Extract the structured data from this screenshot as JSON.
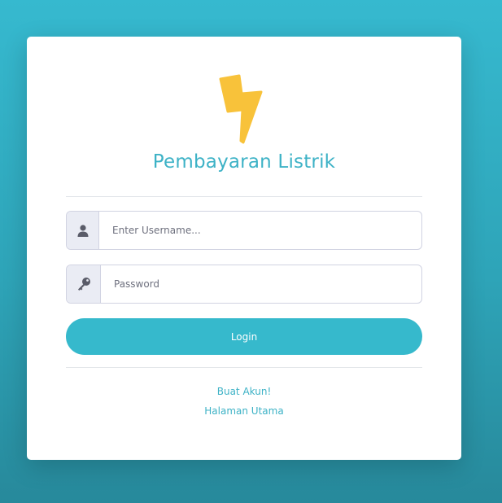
{
  "brand": {
    "title": "Pembayaran Listrik",
    "logo_icon": "lightning-bolt-icon",
    "logo_color": "#f8c23a",
    "accent_color": "#36b9cc"
  },
  "form": {
    "username": {
      "icon": "user-icon",
      "placeholder": "Enter Username...",
      "value": ""
    },
    "password": {
      "icon": "key-icon",
      "placeholder": "Password",
      "value": ""
    },
    "login_label": "Login"
  },
  "links": {
    "register": "Buat Akun!",
    "home": "Halaman Utama"
  }
}
